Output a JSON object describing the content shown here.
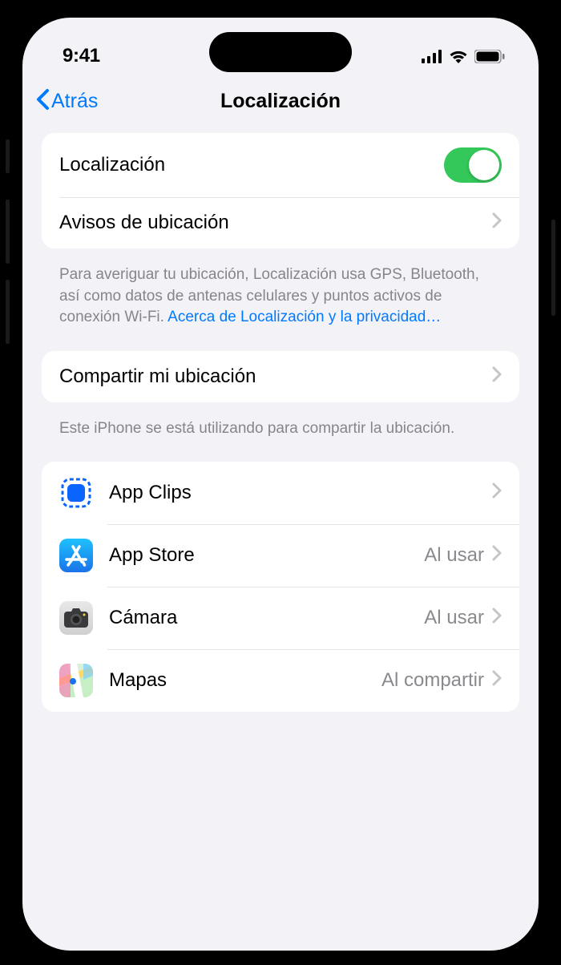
{
  "status": {
    "time": "9:41"
  },
  "nav": {
    "back": "Atrás",
    "title": "Localización"
  },
  "section1": {
    "localization_label": "Localización",
    "location_alerts_label": "Avisos de ubicación"
  },
  "footer1": {
    "text": "Para averiguar tu ubicación, Localización usa GPS, Bluetooth, así como datos de antenas celulares y puntos activos de conexión Wi-Fi. ",
    "link": "Acerca de Localización y la privacidad…"
  },
  "section2": {
    "share_location_label": "Compartir mi ubicación"
  },
  "footer2": {
    "text": "Este iPhone se está utilizando para compartir la ubicación."
  },
  "apps": [
    {
      "name": "App Clips",
      "value": ""
    },
    {
      "name": "App Store",
      "value": "Al usar"
    },
    {
      "name": "Cámara",
      "value": "Al usar"
    },
    {
      "name": "Mapas",
      "value": "Al compartir"
    }
  ]
}
